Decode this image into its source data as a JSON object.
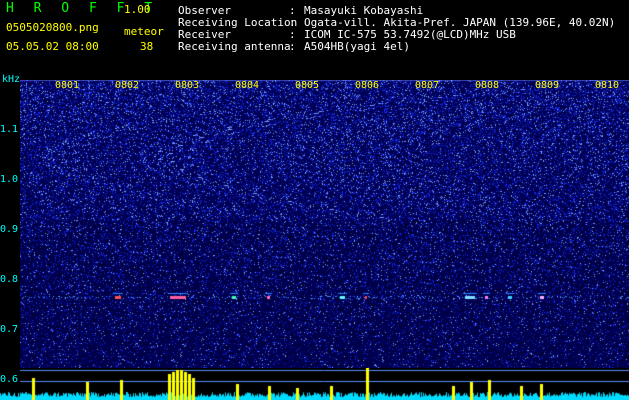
{
  "header": {
    "app_name": "H R O F F T",
    "version": "1.00",
    "filename": "0505020800.png",
    "meteor_label": "meteor",
    "datetime": "05.05.02 08:00",
    "meteor_count": "38"
  },
  "info": [
    {
      "label": "Observer",
      "value": "Masayuki Kobayashi"
    },
    {
      "label": "Receiving Location",
      "value": "Ogata-vill. Akita-Pref. JAPAN (139.96E, 40.02N)"
    },
    {
      "label": "Receiver",
      "value": "ICOM IC-575 53.7492(@LCD)MHz USB"
    },
    {
      "label": "Receiving antenna",
      "value": "A504HB(yagi 4el)"
    }
  ],
  "spectrogram": {
    "unit_label": "kHz",
    "y_ticks": [
      "1.1",
      "1.0",
      "0.9",
      "0.8",
      "0.7",
      "0.6"
    ],
    "x_ticks": [
      "0801",
      "0802",
      "0803",
      "0804",
      "0805",
      "0806",
      "0807",
      "0808",
      "0809",
      "0810"
    ]
  },
  "colors": {
    "background": "#000000",
    "header_title": "#00ff00",
    "header_text": "#ffff00",
    "info_text": "#ffffff",
    "axis_text": "#00ffff",
    "meter_bar": "#ffff00",
    "meter_noise": "#00dcff"
  }
}
